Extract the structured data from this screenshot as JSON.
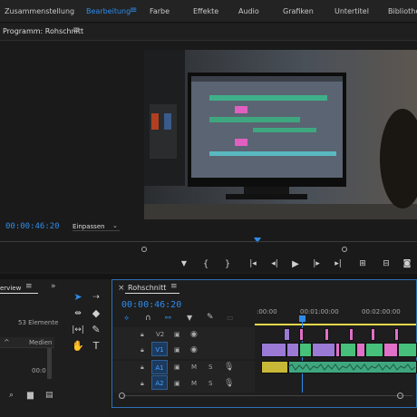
{
  "workspaces": {
    "tabs": [
      {
        "label": "Zusammenstellung",
        "active": false
      },
      {
        "label": "Bearbeitung",
        "active": true
      },
      {
        "label": "Farbe",
        "active": false
      },
      {
        "label": "Effekte",
        "active": false
      },
      {
        "label": "Audio",
        "active": false
      },
      {
        "label": "Grafiken",
        "active": false
      },
      {
        "label": "Untertitel",
        "active": false
      },
      {
        "label": "Bibliothek",
        "active": false
      }
    ],
    "menu_icon": "hamburger-icon"
  },
  "program_monitor": {
    "title": "Programm: Rohschnitt",
    "timecode": "00:00:46:20",
    "zoom_select": "Einpassen"
  },
  "project_panel": {
    "tab_label": "erview",
    "items_count": "53 Elemente",
    "column_header": "Medien",
    "cell_value": "00:0"
  },
  "timeline": {
    "tab_label": "Rohschnitt",
    "timecode": "00:00:46:20",
    "ruler": [
      ":00:00",
      "00:01:00:00",
      "00:02:00:00"
    ],
    "tracks": [
      {
        "label": "V2",
        "kind": "video"
      },
      {
        "label": "V1",
        "kind": "video"
      },
      {
        "label": "A1",
        "kind": "audio"
      },
      {
        "label": "A2",
        "kind": "audio"
      }
    ],
    "mute_label": "M",
    "solo_label": "S"
  },
  "colors": {
    "accent": "#2d8ceb",
    "video_purple": "#9b7ad6",
    "video_pink": "#e070c8",
    "video_green": "#46c07a",
    "audio_green": "#3fa77f"
  }
}
